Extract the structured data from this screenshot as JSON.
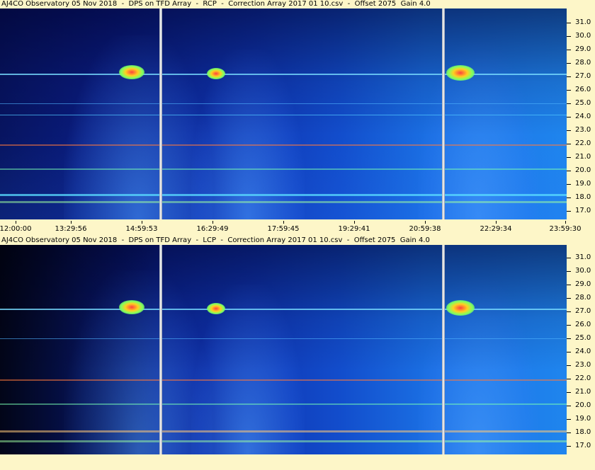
{
  "panels": [
    {
      "title": "AJ4CO Observatory 05 Nov 2018  -  DPS on TFD Array  -  RCP  -  Correction Array 2017 01 10.csv  -  Offset 2075  Gain 4.0",
      "polarization": "RCP"
    },
    {
      "title": "AJ4CO Observatory 05 Nov 2018  -  DPS on TFD Array  -  LCP  -  Correction Array 2017 01 10.csv  -  Offset 2075  Gain 4.0",
      "polarization": "LCP"
    }
  ],
  "frequency_axis": {
    "ticks": [
      "31.0",
      "30.0",
      "29.0",
      "28.0",
      "27.0",
      "26.0",
      "25.0",
      "24.0",
      "23.0",
      "22.0",
      "21.0",
      "20.0",
      "19.0",
      "18.0",
      "17.0"
    ]
  },
  "time_axis": {
    "ticks": [
      "12:00:00",
      "13:29:56",
      "14:59:53",
      "16:29:49",
      "17:59:45",
      "19:29:41",
      "20:59:38",
      "22:29:34",
      "23:59:30"
    ]
  },
  "colors": {
    "background": "#fdf6c8",
    "spectrogram_low": "#071460",
    "spectrogram_high": "#1f85ee",
    "hot": "#ff4040"
  }
}
